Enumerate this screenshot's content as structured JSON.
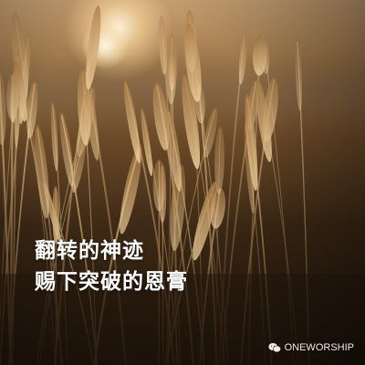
{
  "image": {
    "description_colors": {
      "sky": "#c9a173",
      "grass": "#b98a4c",
      "shadow": "#22170c"
    }
  },
  "headline": {
    "line1": "翻转的神迹",
    "line2": "赐下突破的恩膏"
  },
  "watermark": {
    "icon": "wechat-icon",
    "text": "ONEWORSHIP"
  }
}
